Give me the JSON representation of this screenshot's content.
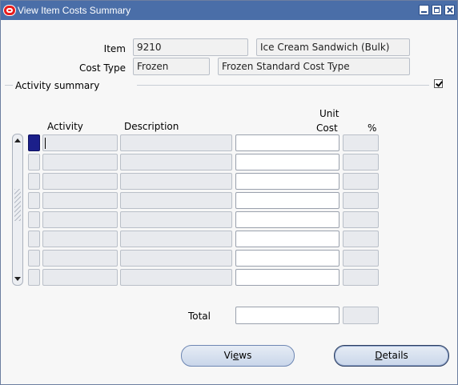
{
  "window": {
    "title": "View Item Costs Summary"
  },
  "header": {
    "item_label": "Item",
    "item_value": "9210",
    "item_description": "Ice Cream Sandwich (Bulk)",
    "cost_type_label": "Cost Type",
    "cost_type_value": "Frozen",
    "cost_type_description": "Frozen Standard Cost Type"
  },
  "activity_summary": {
    "section_label": "Activity summary",
    "checkbox_checked": true,
    "columns": {
      "activity": "Activity",
      "description": "Description",
      "unit_cost_line1": "Unit",
      "unit_cost_line2": "Cost",
      "percent": "%"
    },
    "row_count": 8,
    "rows": [
      {
        "activity": "",
        "description": "",
        "unit_cost": "",
        "percent": ""
      },
      {
        "activity": "",
        "description": "",
        "unit_cost": "",
        "percent": ""
      },
      {
        "activity": "",
        "description": "",
        "unit_cost": "",
        "percent": ""
      },
      {
        "activity": "",
        "description": "",
        "unit_cost": "",
        "percent": ""
      },
      {
        "activity": "",
        "description": "",
        "unit_cost": "",
        "percent": ""
      },
      {
        "activity": "",
        "description": "",
        "unit_cost": "",
        "percent": ""
      },
      {
        "activity": "",
        "description": "",
        "unit_cost": "",
        "percent": ""
      },
      {
        "activity": "",
        "description": "",
        "unit_cost": "",
        "percent": ""
      }
    ],
    "total_label": "Total",
    "total_unit_cost": "",
    "total_percent": ""
  },
  "buttons": {
    "views_pre": "Vi",
    "views_mnemonic": "e",
    "views_post": "ws",
    "details_pre": "",
    "details_mnemonic": "D",
    "details_post": "etails"
  },
  "colors": {
    "title_bar": "#4a6ea8",
    "active_row": "#1b1f8a"
  }
}
